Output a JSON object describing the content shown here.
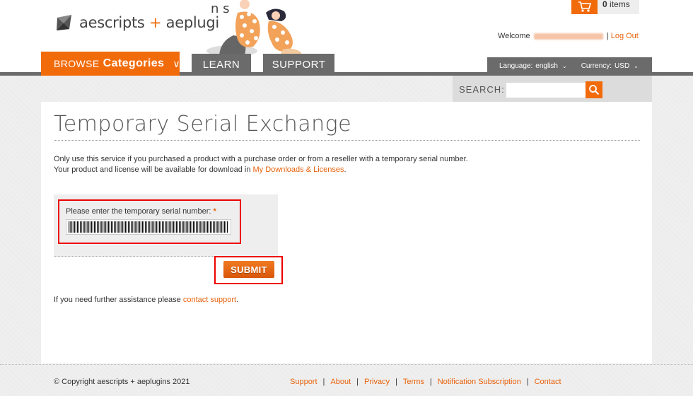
{
  "header": {
    "logo_text_a": "aescripts",
    "logo_plus": "+",
    "logo_text_b": "aeplugi",
    "logo_wave": "n s",
    "cart_count": "0",
    "cart_label": "items",
    "welcome_label": "Welcome",
    "logout": "Log Out"
  },
  "nav": {
    "browse": "BROWSE",
    "categories": "Categories",
    "chevron": "∨",
    "learn": "LEARN",
    "support": "SUPPORT"
  },
  "langbar": {
    "language_label": "Language:",
    "language_value": "english",
    "currency_label": "Currency:",
    "currency_value": "USD",
    "dropdown_glyph": "⌄"
  },
  "search": {
    "label": "SEARCH:",
    "placeholder": ""
  },
  "main": {
    "title": "Temporary Serial Exchange",
    "intro_line1": "Only use this service if you purchased a product with a purchase order or from a reseller with a temporary serial number.",
    "intro_line2_prefix": "Your product and license will be available for download in ",
    "intro_link": "My Downloads & Licenses",
    "intro_suffix": ".",
    "field_label": "Please enter the temporary serial number:",
    "required_mark": "*",
    "submit": "SUBMIT",
    "help_prefix": "If you need further assistance please ",
    "help_link": "contact support",
    "help_suffix": "."
  },
  "footer": {
    "copyright": "© Copyright aescripts + aeplugins 2021",
    "links": [
      "Support",
      "About",
      "Privacy",
      "Terms",
      "Notification Subscription",
      "Contact"
    ],
    "separator": "|"
  },
  "colors": {
    "accent": "#f26b0b",
    "nav_gray": "#6b6b6b",
    "highlight_red": "#e00000"
  }
}
